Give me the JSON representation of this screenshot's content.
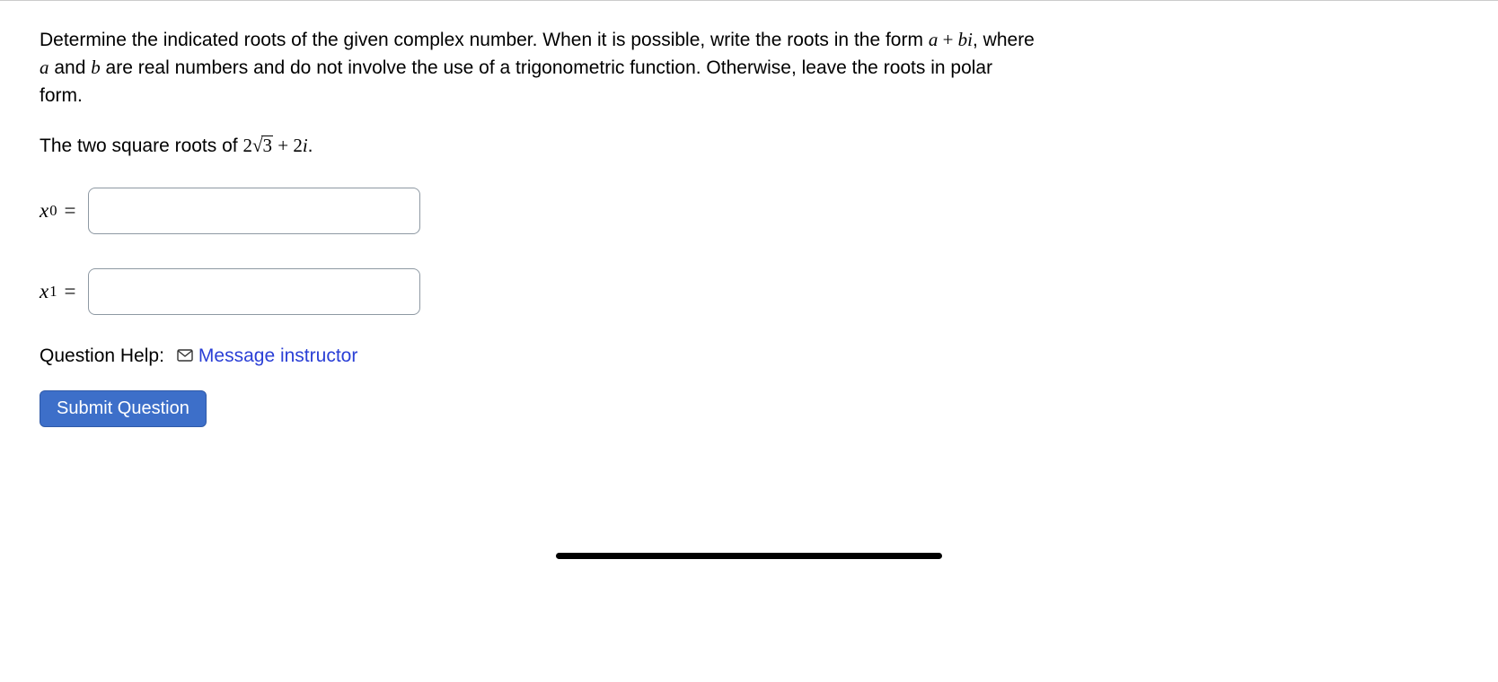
{
  "question": {
    "prompt_part1": "Determine the indicated roots of the given complex number. When it is possible, write the roots in the form ",
    "prompt_form_a": "a",
    "prompt_form_plus": " + ",
    "prompt_form_bi": "bi",
    "prompt_part2": ", where ",
    "prompt_var_a": "a",
    "prompt_and": " and ",
    "prompt_var_b": "b",
    "prompt_part3": " are real numbers and do not involve the use of a trigonometric function. Otherwise, leave the roots in polar form.",
    "sub_prefix": "The two square roots of ",
    "expr_coef1": "2",
    "expr_radicand": "3",
    "expr_plus": " + ",
    "expr_coef2": "2",
    "expr_i": "i",
    "expr_period": "."
  },
  "answers": {
    "x0": {
      "var": "x",
      "sub": "0",
      "eq": "=",
      "value": ""
    },
    "x1": {
      "var": "x",
      "sub": "1",
      "eq": "=",
      "value": ""
    }
  },
  "help": {
    "label": "Question Help:",
    "link_text": "Message instructor"
  },
  "buttons": {
    "submit": "Submit Question"
  }
}
